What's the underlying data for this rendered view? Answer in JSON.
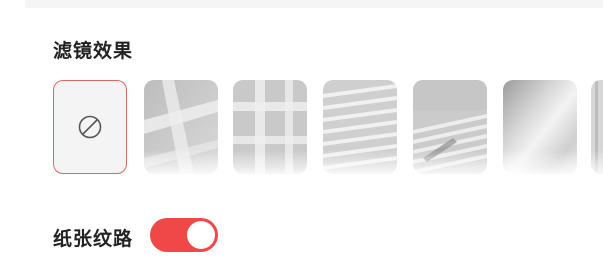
{
  "filter_section": {
    "title": "滤镜效果",
    "options": [
      {
        "id": "none",
        "icon": "no-filter-icon",
        "selected": true
      },
      {
        "id": "window-grid-diagonal",
        "icon": "window-shadow-texture",
        "selected": false
      },
      {
        "id": "window-grid",
        "icon": "window-frame-shadow-texture",
        "selected": false
      },
      {
        "id": "blinds",
        "icon": "blinds-shadow-texture",
        "selected": false
      },
      {
        "id": "blinds-diagonal",
        "icon": "blinds-diagonal-texture",
        "selected": false
      },
      {
        "id": "soft-light",
        "icon": "soft-light-texture",
        "selected": false
      },
      {
        "id": "partial",
        "icon": "texture-partial",
        "selected": false
      }
    ]
  },
  "paper_texture": {
    "label": "纸张纹路",
    "enabled": true
  },
  "colors": {
    "accent": "#f04848",
    "selected_border": "#d86a6a",
    "tile_gray": "#c8c8c8"
  }
}
